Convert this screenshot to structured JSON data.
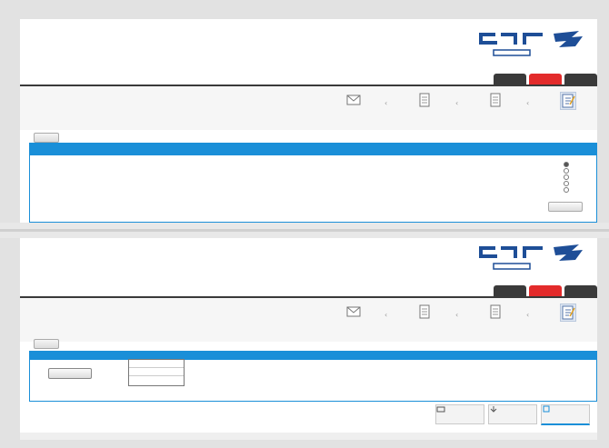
{
  "colors": {
    "brand_blue": "#1e4e97",
    "header_blue": "#1a8fd8",
    "tab_dark": "#3a3a3a",
    "tab_red": "#e32b2b",
    "alert_red": "#c0392b"
  },
  "icons": {
    "workflow_step_icons": [
      "edit-form-icon",
      "document-icon",
      "document-icon",
      "envelope-icon"
    ],
    "tool_icons": [
      "print-icon",
      "download-icon",
      "export-icon"
    ]
  },
  "top": {
    "header": {
      "alert_text": "",
      "info_lines": [
        "",
        "",
        ""
      ],
      "info_link": "",
      "address_bar": ""
    },
    "tabs": [
      {
        "label": "",
        "active": false
      },
      {
        "label": "",
        "active": true
      },
      {
        "label": "",
        "active": false
      }
    ],
    "steps": [
      {
        "label": "",
        "active": true
      },
      {
        "label": "",
        "active": false
      },
      {
        "label": "",
        "active": false
      },
      {
        "label": "",
        "active": false
      }
    ],
    "small_button_label": "",
    "box_title": "",
    "radio_options": [
      {
        "label": "",
        "selected": true
      },
      {
        "label": "",
        "selected": false
      },
      {
        "label": "",
        "selected": false
      },
      {
        "label": "",
        "selected": false
      },
      {
        "label": "",
        "selected": false
      }
    ],
    "ok_button_label": ""
  },
  "bottom": {
    "header": {
      "alert_text": "",
      "info_lines": [
        "",
        "",
        ""
      ],
      "info_link": "",
      "address_bar": ""
    },
    "tabs": [
      {
        "label": "",
        "active": false
      },
      {
        "label": "",
        "active": true
      },
      {
        "label": "",
        "active": false
      }
    ],
    "steps": [
      {
        "label": "",
        "active": true
      },
      {
        "label": "",
        "active": false
      },
      {
        "label": "",
        "active": false
      },
      {
        "label": "",
        "active": false
      }
    ],
    "small_button_label": "",
    "box_title": "",
    "result": {
      "labels_row1": [
        "",
        "",
        "",
        "",
        ""
      ],
      "labels_row2": [
        "",
        "",
        "",
        "",
        "",
        ""
      ],
      "mini_table_rows": [
        {
          "a": "",
          "b": ""
        },
        {
          "a": "",
          "b": ""
        },
        {
          "a": "",
          "b": ""
        }
      ],
      "action_button_label": ""
    },
    "tools": [
      {
        "label": "",
        "active": true
      },
      {
        "label": "",
        "active": false
      },
      {
        "label": "",
        "active": false
      }
    ]
  }
}
